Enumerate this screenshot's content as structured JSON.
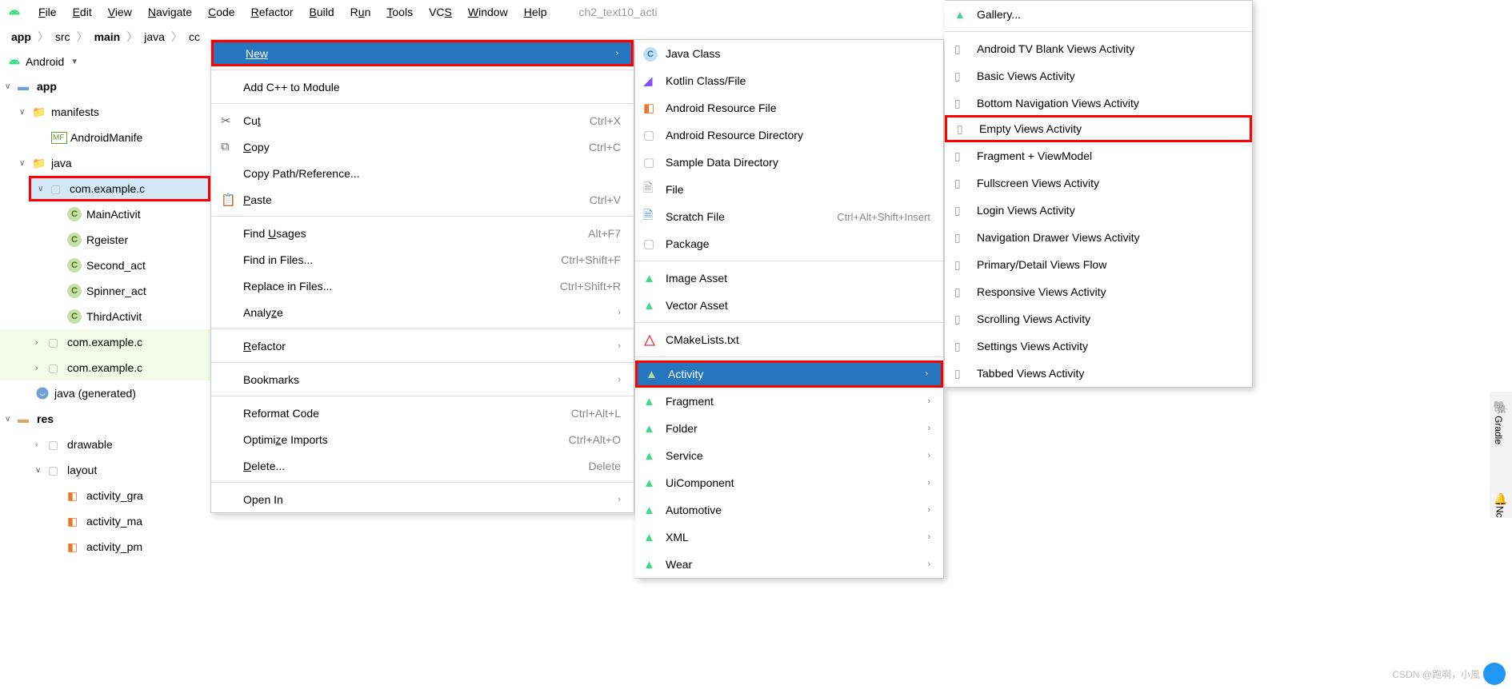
{
  "menubar": {
    "items": [
      "File",
      "Edit",
      "View",
      "Navigate",
      "Code",
      "Refactor",
      "Build",
      "Run",
      "Tools",
      "VCS",
      "Window",
      "Help"
    ],
    "recent": "ch2_text10_acti"
  },
  "breadcrumb": [
    "app",
    "src",
    "main",
    "java",
    "cc"
  ],
  "sidebar": {
    "title": "Android",
    "tree": {
      "app": "app",
      "manifests": "manifests",
      "android_manifest": "AndroidManife",
      "java": "java",
      "package": "com.example.c",
      "classes": [
        "MainActivit",
        "Rgeister",
        "Second_act",
        "Spinner_act",
        "ThirdActivit"
      ],
      "test_pkg1": "com.example.c",
      "test_pkg2": "com.example.c",
      "generated": "java (generated)",
      "res": "res",
      "drawable": "drawable",
      "layout": "layout",
      "layouts": [
        "activity_gra",
        "activity_ma",
        "activity_pm"
      ]
    }
  },
  "context_menu": {
    "new": "New",
    "add_cpp": "Add C++ to Module",
    "cut": {
      "label": "Cut",
      "shortcut": "Ctrl+X"
    },
    "copy": {
      "label": "Copy",
      "shortcut": "Ctrl+C"
    },
    "copy_path": "Copy Path/Reference...",
    "paste": {
      "label": "Paste",
      "shortcut": "Ctrl+V"
    },
    "find_usages": {
      "label": "Find Usages",
      "shortcut": "Alt+F7"
    },
    "find_in_files": {
      "label": "Find in Files...",
      "shortcut": "Ctrl+Shift+F"
    },
    "replace_in_files": {
      "label": "Replace in Files...",
      "shortcut": "Ctrl+Shift+R"
    },
    "analyze": "Analyze",
    "refactor": "Refactor",
    "bookmarks": "Bookmarks",
    "reformat": {
      "label": "Reformat Code",
      "shortcut": "Ctrl+Alt+L"
    },
    "optimize": {
      "label": "Optimize Imports",
      "shortcut": "Ctrl+Alt+O"
    },
    "delete": {
      "label": "Delete...",
      "shortcut": "Delete"
    },
    "open_in": "Open In"
  },
  "new_submenu": {
    "java_class": "Java Class",
    "kotlin": "Kotlin Class/File",
    "res_file": "Android Resource File",
    "res_dir": "Android Resource Directory",
    "sample": "Sample Data Directory",
    "file": "File",
    "scratch": {
      "label": "Scratch File",
      "shortcut": "Ctrl+Alt+Shift+Insert"
    },
    "package": "Package",
    "image_asset": "Image Asset",
    "vector_asset": "Vector Asset",
    "cmake": "CMakeLists.txt",
    "activity": "Activity",
    "fragment": "Fragment",
    "folder": "Folder",
    "service": "Service",
    "ui_component": "UiComponent",
    "automotive": "Automotive",
    "xml": "XML",
    "wear": "Wear"
  },
  "activity_submenu": {
    "gallery": "Gallery...",
    "items": [
      "Android TV Blank Views Activity",
      "Basic Views Activity",
      "Bottom Navigation Views Activity",
      "Empty Views Activity",
      "Fragment + ViewModel",
      "Fullscreen Views Activity",
      "Login Views Activity",
      "Navigation Drawer Views Activity",
      "Primary/Detail Views Flow",
      "Responsive Views Activity",
      "Scrolling Views Activity",
      "Settings Views Activity",
      "Tabbed Views Activity"
    ]
  },
  "right_sidebar": {
    "gradle": "Gradle",
    "notif": "Nc"
  },
  "watermark": "CSDN @跑啊，小風"
}
